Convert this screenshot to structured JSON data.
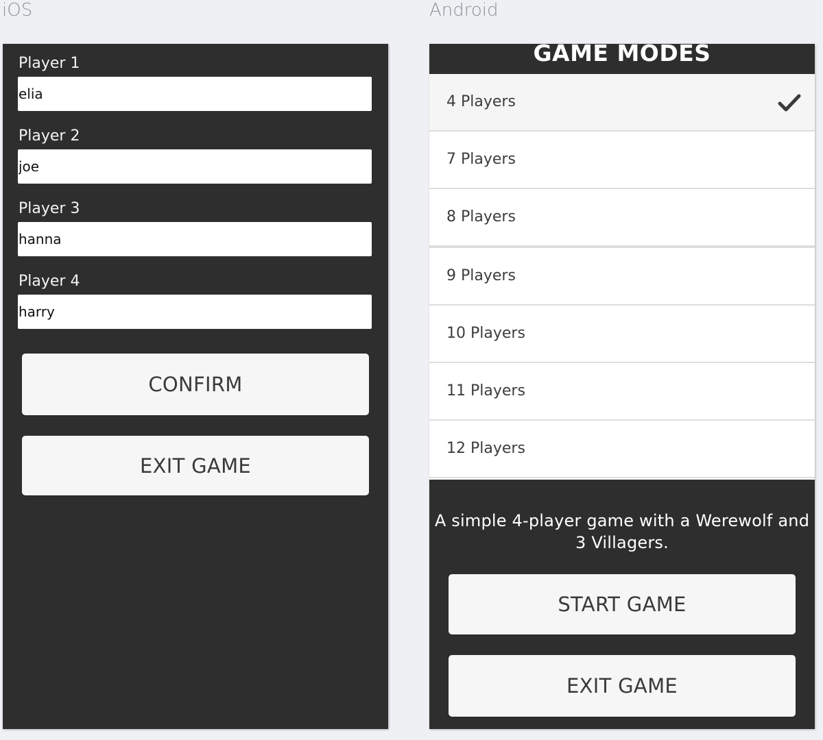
{
  "labels": {
    "ios": "iOS",
    "android": "Android"
  },
  "ios": {
    "players": [
      {
        "label": "Player 1",
        "value": "elia"
      },
      {
        "label": "Player 2",
        "value": "joe"
      },
      {
        "label": "Player 3",
        "value": "hanna"
      },
      {
        "label": "Player 4",
        "value": "harry"
      }
    ],
    "confirm_label": "CONFIRM",
    "exit_label": "EXIT GAME"
  },
  "android": {
    "header_title": "GAME MODES",
    "modes": [
      {
        "label": "4 Players",
        "selected": true
      },
      {
        "label": "7 Players",
        "selected": false
      },
      {
        "label": "8 Players",
        "selected": false
      },
      {
        "label": "9 Players",
        "selected": false
      },
      {
        "label": "10 Players",
        "selected": false
      },
      {
        "label": "11 Players",
        "selected": false
      },
      {
        "label": "12 Players",
        "selected": false
      }
    ],
    "selected_icon": "checkmark-icon",
    "description": "A simple 4-player game with a Werewolf and 3 Villagers.",
    "start_label": "START GAME",
    "exit_label": "EXIT GAME"
  },
  "colors": {
    "page_background": "#eff0f4",
    "panel_background": "#2e2e2e",
    "button_background": "#f6f6f6",
    "selected_row": "#f5f5f5"
  }
}
